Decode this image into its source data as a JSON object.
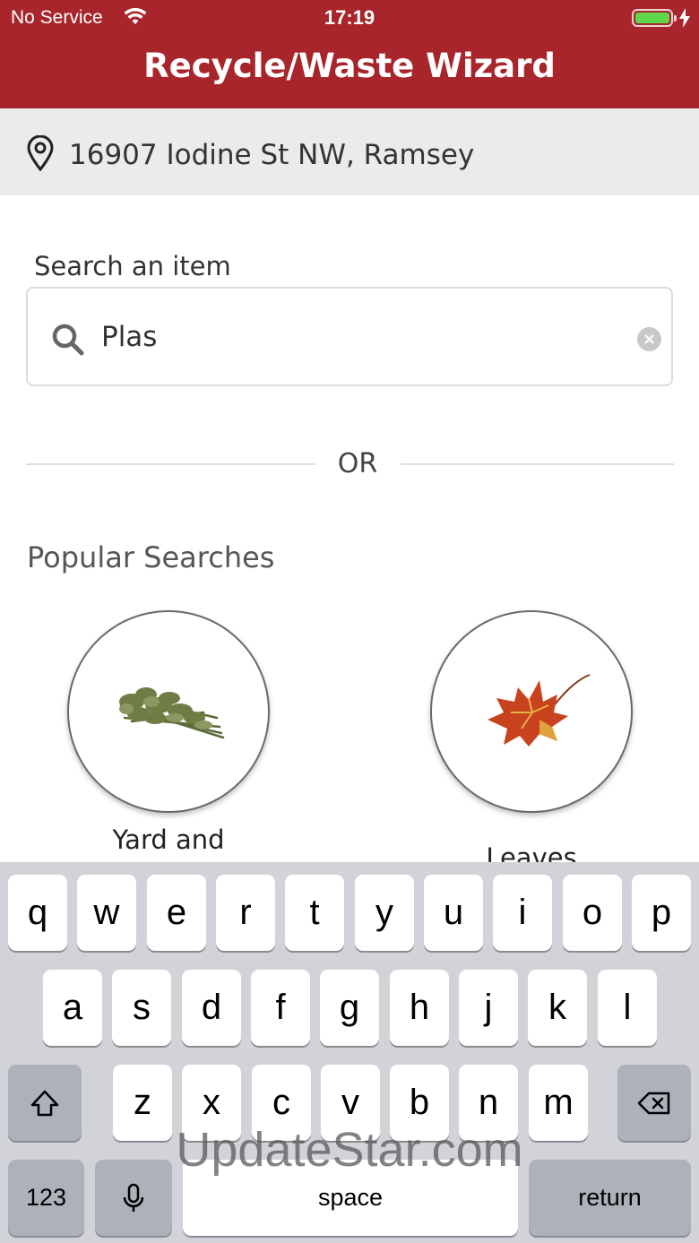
{
  "status_bar": {
    "carrier": "No Service",
    "time": "17:19"
  },
  "header": {
    "title": "Recycle/Waste Wizard"
  },
  "address": {
    "text": "16907 Iodine St NW, Ramsey"
  },
  "search": {
    "label": "Search an item",
    "value": "Plas",
    "clear": "×"
  },
  "divider": {
    "text": "OR"
  },
  "popular": {
    "title": "Popular Searches",
    "items": [
      {
        "label": "Yard and",
        "icon": "yard-waste-image"
      },
      {
        "label": "Leaves",
        "icon": "maple-leaf-image"
      }
    ]
  },
  "keyboard": {
    "row1": [
      "q",
      "w",
      "e",
      "r",
      "t",
      "y",
      "u",
      "i",
      "o",
      "p"
    ],
    "row2": [
      "a",
      "s",
      "d",
      "f",
      "g",
      "h",
      "j",
      "k",
      "l"
    ],
    "row3": [
      "z",
      "x",
      "c",
      "v",
      "b",
      "n",
      "m"
    ],
    "numbers": "123",
    "space": "space",
    "return": "return"
  },
  "watermark": "UpdateStar.com",
  "colors": {
    "brand": "#a8262b",
    "address_bg": "#ebebeb",
    "keyboard_bg": "#d1d3d9"
  }
}
